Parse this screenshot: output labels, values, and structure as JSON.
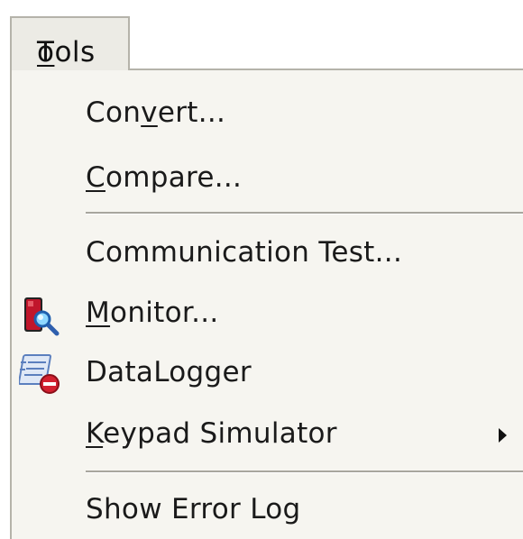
{
  "menubar": {
    "title_first": "T",
    "title_rest": "ools"
  },
  "menu": {
    "items": [
      {
        "pre": "Con",
        "mnemonic": "v",
        "post": "ert..."
      },
      {
        "pre": "",
        "mnemonic": "C",
        "post": "ompare..."
      },
      {
        "label": "Communication Test..."
      },
      {
        "pre": "",
        "mnemonic": "M",
        "post": "onitor...",
        "icon": "monitor-icon"
      },
      {
        "label": "DataLogger",
        "icon": "datalogger-icon"
      },
      {
        "pre": "",
        "mnemonic": "K",
        "post": "eypad Simulator",
        "submenu": true
      },
      {
        "label": "Show Error Log"
      }
    ]
  },
  "colors": {
    "menu_background": "#f6f5f0",
    "menubar_background": "#ecebe5",
    "separator": "#a8a69e",
    "text": "#1a1a1a"
  }
}
